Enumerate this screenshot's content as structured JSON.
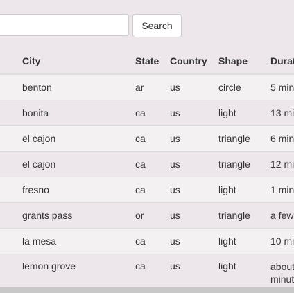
{
  "search": {
    "value": "",
    "placeholder": "",
    "button_label": "Search"
  },
  "table": {
    "headers": {
      "city": "City",
      "state": "State",
      "country": "Country",
      "shape": "Shape",
      "duration": "Durat"
    },
    "rows": [
      {
        "city": "benton",
        "state": "ar",
        "country": "us",
        "shape": "circle",
        "duration": "5 min"
      },
      {
        "city": "bonita",
        "state": "ca",
        "country": "us",
        "shape": "light",
        "duration": "13 mi"
      },
      {
        "city": "el cajon",
        "state": "ca",
        "country": "us",
        "shape": "triangle",
        "duration": "6 min"
      },
      {
        "city": "el cajon",
        "state": "ca",
        "country": "us",
        "shape": "triangle",
        "duration": "12 mi"
      },
      {
        "city": "fresno",
        "state": "ca",
        "country": "us",
        "shape": "light",
        "duration": "1 min"
      },
      {
        "city": "grants pass",
        "state": "or",
        "country": "us",
        "shape": "triangle",
        "duration": "a few"
      },
      {
        "city": "la mesa",
        "state": "ca",
        "country": "us",
        "shape": "light",
        "duration": "10 mi"
      },
      {
        "city": "lemon grove",
        "state": "ca",
        "country": "us",
        "shape": "light",
        "duration": "about minut"
      }
    ]
  }
}
